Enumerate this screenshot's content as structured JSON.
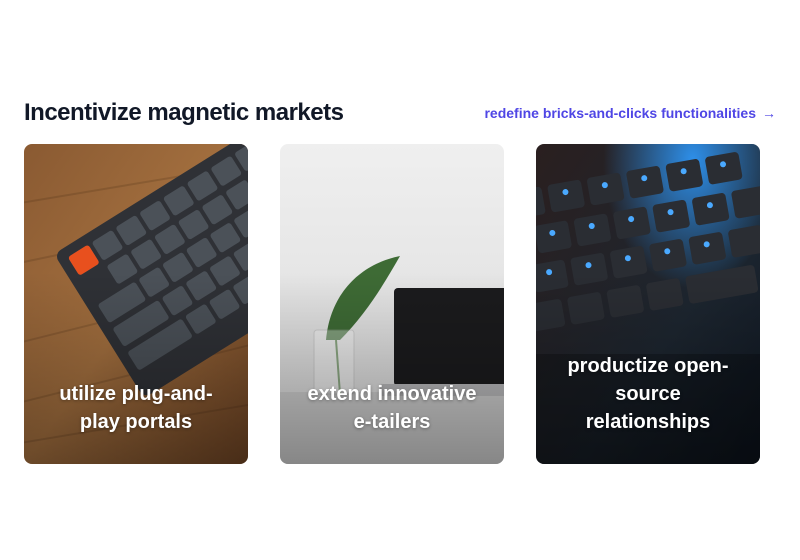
{
  "section": {
    "title": "Incentivize magnetic markets",
    "link_label": "redefine bricks-and-clicks functionalities",
    "link_icon": "arrow-right-icon",
    "link_color": "#4f46e5"
  },
  "cards": [
    {
      "caption": "utilize plug-and-play portals",
      "image": "mechanical-keyboard-on-wood-photo"
    },
    {
      "caption": "extend innovative e-tailers",
      "image": "plant-and-laptop-photo"
    },
    {
      "caption": "productize open-source relationships",
      "image": "backlit-keyboard-photo"
    }
  ]
}
